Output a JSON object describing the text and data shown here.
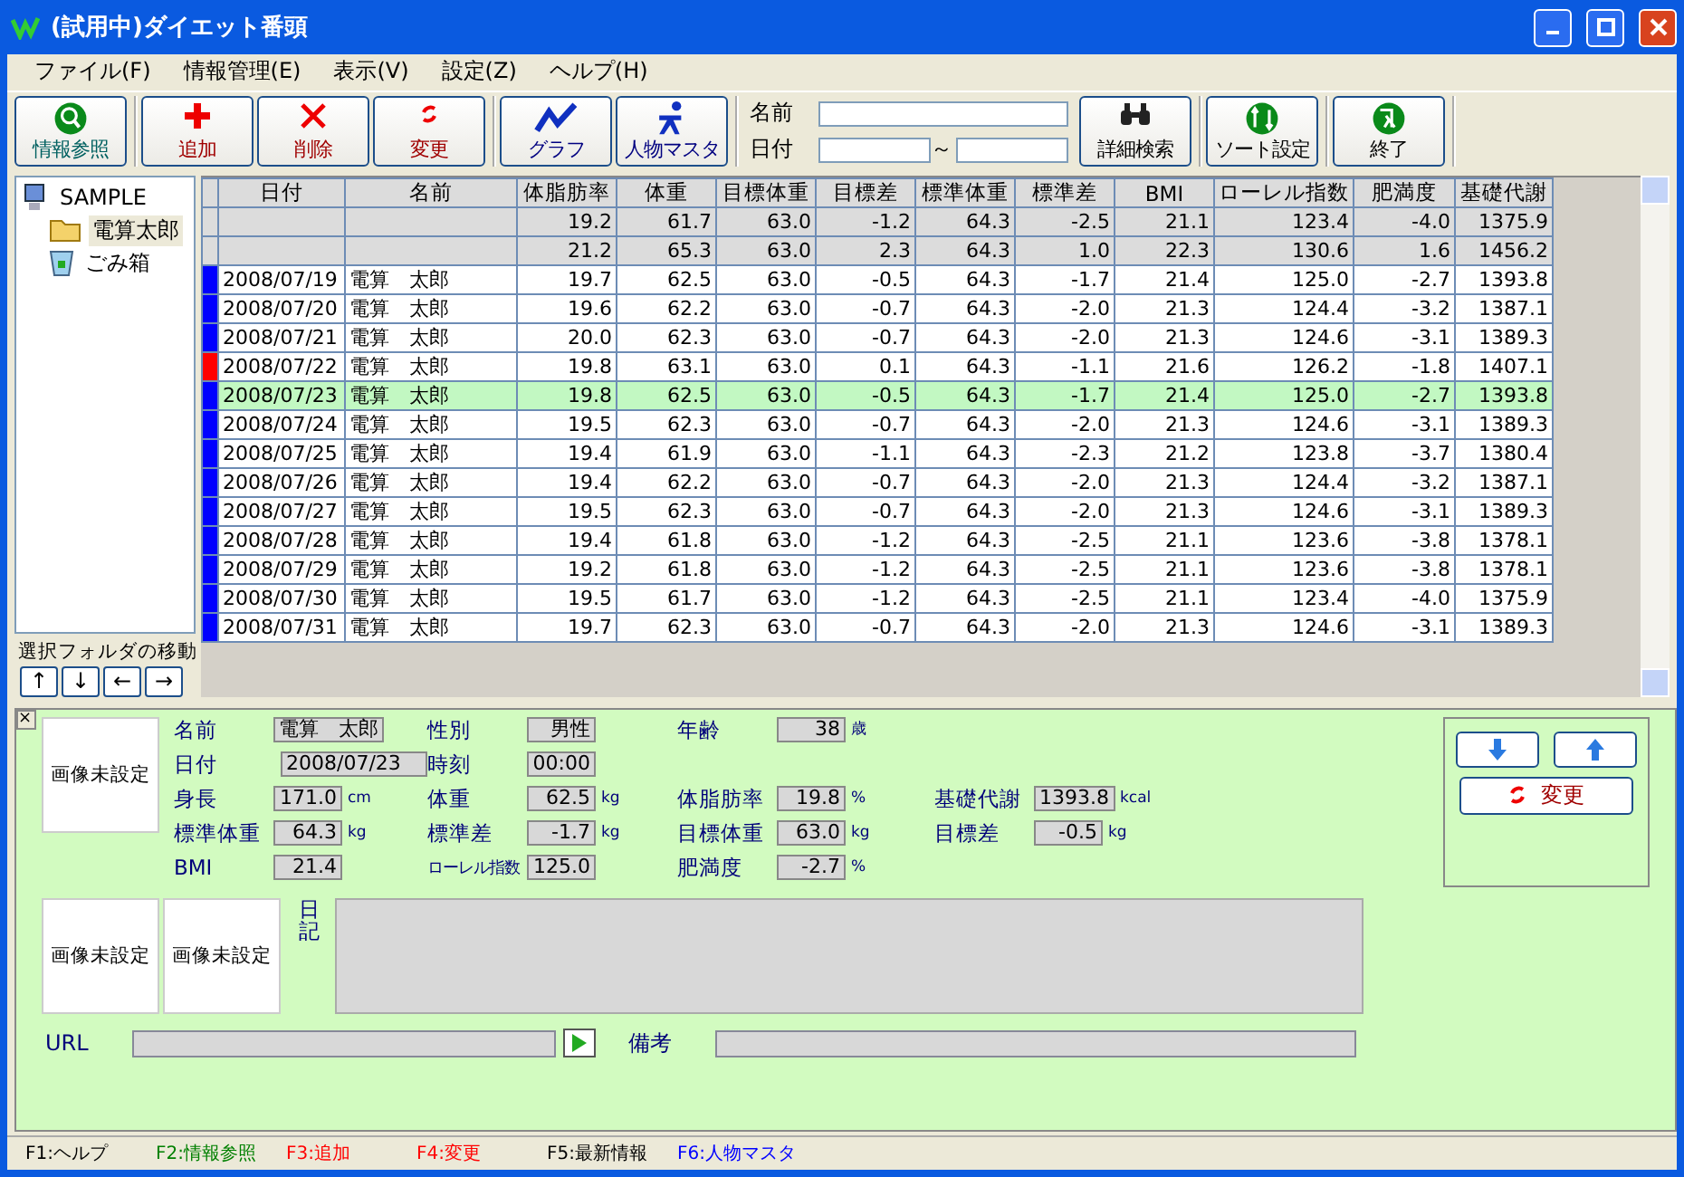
{
  "window": {
    "title": "(試用中)ダイエット番頭"
  },
  "menu": [
    "ファイル(F)",
    "情報管理(E)",
    "表示(V)",
    "設定(Z)",
    "ヘルプ(H)"
  ],
  "toolbar": {
    "groups": [
      [
        {
          "kind": "search",
          "label": "情報参照"
        }
      ],
      [
        {
          "kind": "add",
          "label": "追加"
        },
        {
          "kind": "delete",
          "label": "削除"
        },
        {
          "kind": "change",
          "label": "変更"
        }
      ],
      [
        {
          "kind": "graph",
          "label": "グラフ"
        },
        {
          "kind": "person",
          "label": "人物マスタ"
        }
      ]
    ],
    "search": {
      "name_label": "名前",
      "date_label": "日付",
      "range_sep": "～"
    },
    "right_groups": [
      [
        {
          "kind": "binoculars",
          "label": "詳細検索"
        }
      ],
      [
        {
          "kind": "sort",
          "label": "ソート設定"
        }
      ],
      [
        {
          "kind": "exit",
          "label": "終了"
        }
      ]
    ]
  },
  "tree": {
    "items": [
      {
        "label": "SAMPLE",
        "kind": "computer",
        "selected": false,
        "children": [
          {
            "label": "電算太郎",
            "kind": "folder",
            "selected": true
          },
          {
            "label": "ごみ箱",
            "kind": "trash",
            "selected": false
          }
        ]
      }
    ]
  },
  "folder_move": {
    "label": "選択フォルダの移動",
    "buttons": [
      "↑",
      "↓",
      "←",
      "→"
    ]
  },
  "table": {
    "columns": [
      "日付",
      "名前",
      "体脂肪率",
      "体重",
      "目標体重",
      "目標差",
      "標準体重",
      "標準差",
      "BMI",
      "ローレル指数",
      "肥満度",
      "基礎代謝"
    ],
    "rows": [
      {
        "kind": "summary",
        "cells": [
          "",
          "",
          "19.2",
          "61.7",
          "63.0",
          "-1.2",
          "64.3",
          "-2.5",
          "21.1",
          "123.4",
          "-4.0",
          "1375.9"
        ]
      },
      {
        "kind": "summary",
        "cells": [
          "",
          "",
          "21.2",
          "65.3",
          "63.0",
          "2.3",
          "64.3",
          "1.0",
          "22.3",
          "130.6",
          "1.6",
          "1456.2"
        ]
      },
      {
        "kind": "record",
        "color": "#0000ff",
        "selected": false,
        "cells": [
          "2008/07/19",
          "電算　太郎",
          "19.7",
          "62.5",
          "63.0",
          "-0.5",
          "64.3",
          "-1.7",
          "21.4",
          "125.0",
          "-2.7",
          "1393.8"
        ]
      },
      {
        "kind": "record",
        "color": "#0000ff",
        "selected": false,
        "cells": [
          "2008/07/20",
          "電算　太郎",
          "19.6",
          "62.2",
          "63.0",
          "-0.7",
          "64.3",
          "-2.0",
          "21.3",
          "124.4",
          "-3.2",
          "1387.1"
        ]
      },
      {
        "kind": "record",
        "color": "#0000ff",
        "selected": false,
        "cells": [
          "2008/07/21",
          "電算　太郎",
          "20.0",
          "62.3",
          "63.0",
          "-0.7",
          "64.3",
          "-2.0",
          "21.3",
          "124.6",
          "-3.1",
          "1389.3"
        ]
      },
      {
        "kind": "record",
        "color": "#ff0000",
        "selected": false,
        "cells": [
          "2008/07/22",
          "電算　太郎",
          "19.8",
          "63.1",
          "63.0",
          "0.1",
          "64.3",
          "-1.1",
          "21.6",
          "126.2",
          "-1.8",
          "1407.1"
        ]
      },
      {
        "kind": "record",
        "color": "#0000ff",
        "selected": true,
        "cells": [
          "2008/07/23",
          "電算　太郎",
          "19.8",
          "62.5",
          "63.0",
          "-0.5",
          "64.3",
          "-1.7",
          "21.4",
          "125.0",
          "-2.7",
          "1393.8"
        ]
      },
      {
        "kind": "record",
        "color": "#0000ff",
        "selected": false,
        "cells": [
          "2008/07/24",
          "電算　太郎",
          "19.5",
          "62.3",
          "63.0",
          "-0.7",
          "64.3",
          "-2.0",
          "21.3",
          "124.6",
          "-3.1",
          "1389.3"
        ]
      },
      {
        "kind": "record",
        "color": "#0000ff",
        "selected": false,
        "cells": [
          "2008/07/25",
          "電算　太郎",
          "19.4",
          "61.9",
          "63.0",
          "-1.1",
          "64.3",
          "-2.3",
          "21.2",
          "123.8",
          "-3.7",
          "1380.4"
        ]
      },
      {
        "kind": "record",
        "color": "#0000ff",
        "selected": false,
        "cells": [
          "2008/07/26",
          "電算　太郎",
          "19.4",
          "62.2",
          "63.0",
          "-0.7",
          "64.3",
          "-2.0",
          "21.3",
          "124.4",
          "-3.2",
          "1387.1"
        ]
      },
      {
        "kind": "record",
        "color": "#0000ff",
        "selected": false,
        "cells": [
          "2008/07/27",
          "電算　太郎",
          "19.5",
          "62.3",
          "63.0",
          "-0.7",
          "64.3",
          "-2.0",
          "21.3",
          "124.6",
          "-3.1",
          "1389.3"
        ]
      },
      {
        "kind": "record",
        "color": "#0000ff",
        "selected": false,
        "cells": [
          "2008/07/28",
          "電算　太郎",
          "19.4",
          "61.8",
          "63.0",
          "-1.2",
          "64.3",
          "-2.5",
          "21.1",
          "123.6",
          "-3.8",
          "1378.1"
        ]
      },
      {
        "kind": "record",
        "color": "#0000ff",
        "selected": false,
        "cells": [
          "2008/07/29",
          "電算　太郎",
          "19.2",
          "61.8",
          "63.0",
          "-1.2",
          "64.3",
          "-2.5",
          "21.1",
          "123.6",
          "-3.8",
          "1378.1"
        ]
      },
      {
        "kind": "record",
        "color": "#0000ff",
        "selected": false,
        "cells": [
          "2008/07/30",
          "電算　太郎",
          "19.5",
          "61.7",
          "63.0",
          "-1.2",
          "64.3",
          "-2.5",
          "21.1",
          "123.4",
          "-4.0",
          "1375.9"
        ]
      },
      {
        "kind": "record",
        "color": "#0000ff",
        "selected": false,
        "cells": [
          "2008/07/31",
          "電算　太郎",
          "19.7",
          "62.3",
          "63.0",
          "-0.7",
          "64.3",
          "-2.0",
          "21.3",
          "124.6",
          "-3.1",
          "1389.3"
        ]
      }
    ]
  },
  "detail": {
    "close": "×",
    "photo": "画像未設定",
    "rows": [
      [
        {
          "label": "名前",
          "value": "電算　太郎"
        },
        {
          "label": "性別",
          "value": "男性"
        },
        {
          "label": "年齢",
          "value": "38",
          "unit": "歳"
        }
      ],
      [
        {
          "label": "日付",
          "value": "2008/07/23"
        },
        {
          "label": "時刻",
          "value": "00:00"
        }
      ],
      [
        {
          "label": "身長",
          "value": "171.0",
          "unit": "cm"
        },
        {
          "label": "体重",
          "value": "62.5",
          "unit": "kg"
        },
        {
          "label": "体脂肪率",
          "value": "19.8",
          "unit": "%"
        },
        {
          "label": "基礎代謝",
          "value": "1393.8",
          "unit": "kcal"
        }
      ],
      [
        {
          "label": "標準体重",
          "value": "64.3",
          "unit": "kg"
        },
        {
          "label": "標準差",
          "value": "-1.7",
          "unit": "kg"
        },
        {
          "label": "目標体重",
          "value": "63.0",
          "unit": "kg"
        },
        {
          "label": "目標差",
          "value": "-0.5",
          "unit": "kg"
        }
      ],
      [
        {
          "label": "BMI",
          "value": "21.4"
        },
        {
          "label": "ローレル指数",
          "value": "125.0"
        },
        {
          "label": "肥満度",
          "value": "-2.7",
          "unit": "%"
        }
      ]
    ],
    "change_button": "変更",
    "photos": [
      "画像未設定",
      "画像未設定"
    ],
    "diary_label": "日記",
    "url_label": "URL",
    "note_label": "備考"
  },
  "status_bar": [
    {
      "label": "F1:ヘルプ",
      "color": "#000000"
    },
    {
      "label": "F2:情報参照",
      "color": "#008000"
    },
    {
      "label": "F3:追加",
      "color": "#ff0000"
    },
    {
      "label": "F4:変更",
      "color": "#ff0000"
    },
    {
      "label": "F5:最新情報",
      "color": "#000000"
    },
    {
      "label": "F6:人物マスタ",
      "color": "#0000ff"
    }
  ]
}
